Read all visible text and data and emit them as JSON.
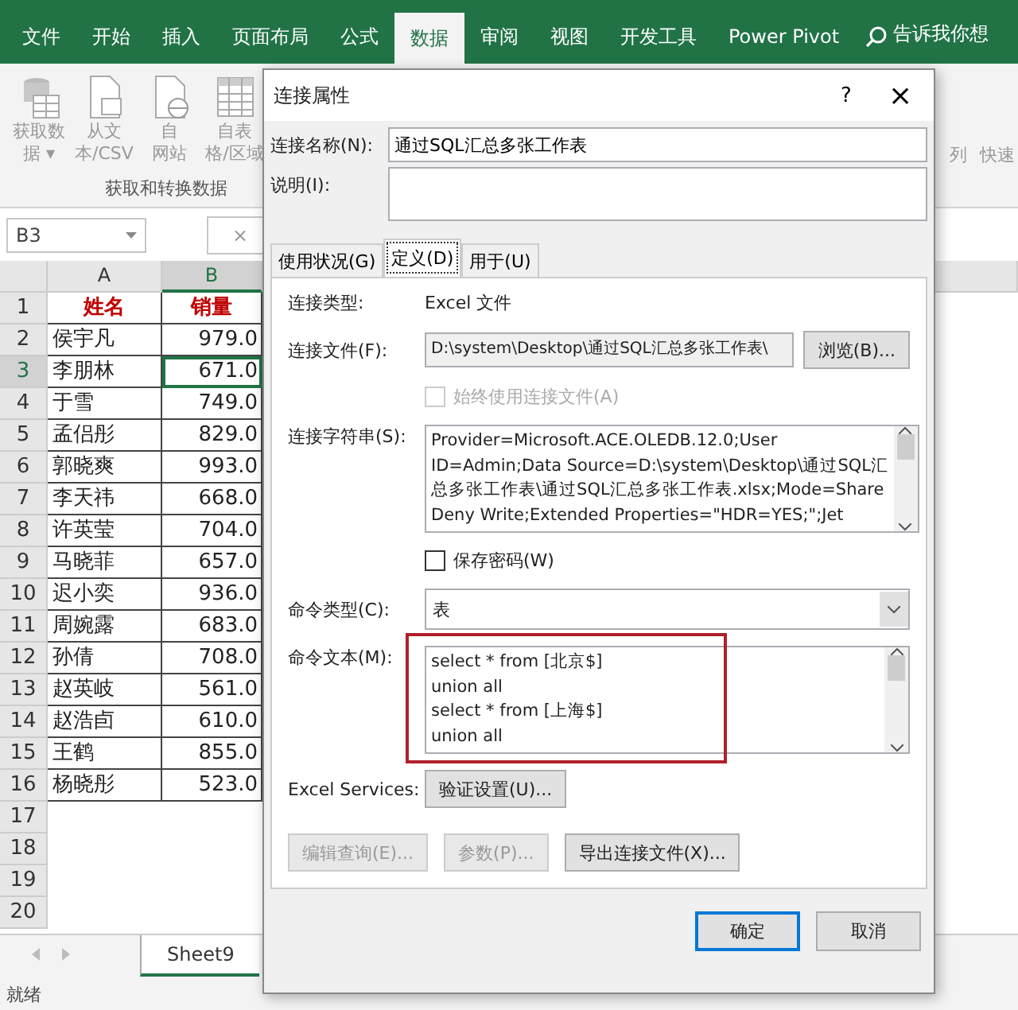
{
  "ribbon_tabs": [
    {
      "label": "文件",
      "selected": false
    },
    {
      "label": "开始",
      "selected": false
    },
    {
      "label": "插入",
      "selected": false
    },
    {
      "label": "页面布局",
      "selected": false
    },
    {
      "label": "公式",
      "selected": false
    },
    {
      "label": "数据",
      "selected": true
    },
    {
      "label": "审阅",
      "selected": false
    },
    {
      "label": "视图",
      "selected": false
    },
    {
      "label": "开发工具",
      "selected": false
    },
    {
      "label": "Power Pivot",
      "selected": false
    }
  ],
  "tell_me": "告诉我你想",
  "ribbon_buttons": [
    {
      "kind": "database",
      "lines": [
        "获取数",
        "据 ▾"
      ]
    },
    {
      "kind": "document",
      "lines": [
        "从文",
        "本/CSV"
      ]
    },
    {
      "kind": "web",
      "lines": [
        "自",
        "网站"
      ]
    },
    {
      "kind": "table",
      "lines": [
        "自表",
        "格/区域"
      ]
    }
  ],
  "ribbon_group": "获取和转换数据",
  "ribbon_right": [
    "列",
    "快速"
  ],
  "name_box": "B3",
  "formula_cancel": "×",
  "sheet": {
    "columns": [
      {
        "label": "A",
        "selected": false
      },
      {
        "label": "B",
        "selected": true
      }
    ],
    "rows": [
      {
        "num": "1",
        "selected": false,
        "cells": [
          "姓名",
          "销量"
        ],
        "kind": "header"
      },
      {
        "num": "2",
        "selected": false,
        "cells": [
          "侯宇凡",
          "979.0"
        ],
        "kind": "data"
      },
      {
        "num": "3",
        "selected": true,
        "cells": [
          "李朋林",
          "671.0"
        ],
        "kind": "data"
      },
      {
        "num": "4",
        "selected": false,
        "cells": [
          "于雪",
          "749.0"
        ],
        "kind": "data"
      },
      {
        "num": "5",
        "selected": false,
        "cells": [
          "孟侣彤",
          "829.0"
        ],
        "kind": "data"
      },
      {
        "num": "6",
        "selected": false,
        "cells": [
          "郭晓爽",
          "993.0"
        ],
        "kind": "data"
      },
      {
        "num": "7",
        "selected": false,
        "cells": [
          "李天祎",
          "668.0"
        ],
        "kind": "data"
      },
      {
        "num": "8",
        "selected": false,
        "cells": [
          "许英莹",
          "704.0"
        ],
        "kind": "data"
      },
      {
        "num": "9",
        "selected": false,
        "cells": [
          "马晓菲",
          "657.0"
        ],
        "kind": "data"
      },
      {
        "num": "10",
        "selected": false,
        "cells": [
          "迟小奕",
          "936.0"
        ],
        "kind": "data"
      },
      {
        "num": "11",
        "selected": false,
        "cells": [
          "周婉露",
          "683.0"
        ],
        "kind": "data"
      },
      {
        "num": "12",
        "selected": false,
        "cells": [
          "孙倩",
          "708.0"
        ],
        "kind": "data"
      },
      {
        "num": "13",
        "selected": false,
        "cells": [
          "赵英岐",
          "561.0"
        ],
        "kind": "data"
      },
      {
        "num": "14",
        "selected": false,
        "cells": [
          "赵浩卣",
          "610.0"
        ],
        "kind": "data"
      },
      {
        "num": "15",
        "selected": false,
        "cells": [
          "王鹤",
          "855.0"
        ],
        "kind": "data"
      },
      {
        "num": "16",
        "selected": false,
        "cells": [
          "杨晓彤",
          "523.0"
        ],
        "kind": "data"
      },
      {
        "num": "17",
        "selected": false,
        "cells": [],
        "kind": "empty"
      },
      {
        "num": "18",
        "selected": false,
        "cells": [],
        "kind": "empty"
      },
      {
        "num": "19",
        "selected": false,
        "cells": [],
        "kind": "empty"
      },
      {
        "num": "20",
        "selected": false,
        "cells": [],
        "kind": "empty"
      }
    ]
  },
  "sheet_tabs": [
    {
      "label": "Sheet9",
      "selected": true
    }
  ],
  "status_bar": "就绪",
  "dialog": {
    "title": "连接属性",
    "help": "?",
    "close": "×",
    "name_label": "连接名称(N):",
    "name_value": "通过SQL汇总多张工作表",
    "desc_label": "说明(I):",
    "tabs": [
      {
        "label": "使用状况(G)",
        "selected": false
      },
      {
        "label": "定义(D)",
        "selected": true
      },
      {
        "label": "用于(U)",
        "selected": false
      }
    ],
    "type_label": "连接类型:",
    "type_value": "Excel 文件",
    "file_label": "连接文件(F):",
    "file_value": "D:\\system\\Desktop\\通过SQL汇总多张工作表\\",
    "browse": "浏览(B)...",
    "always_use": {
      "label": "始终使用连接文件(A)",
      "checked": false,
      "disabled": true
    },
    "conn_label": "连接字符串(S):",
    "conn_lines": [
      "Provider=Microsoft.ACE.OLEDB.12.0;User",
      "ID=Admin;Data Source=D:\\system\\Desktop\\通过SQL汇",
      "总多张工作表\\通过SQL汇总多张工作表.xlsx;Mode=Share",
      "Deny Write;Extended Properties=\"HDR=YES;\";Jet"
    ],
    "save_password": {
      "label": "保存密码(W)",
      "checked": false,
      "disabled": false
    },
    "cmd_type_label": "命令类型(C):",
    "cmd_type_value": "表",
    "cmd_text_label": "命令文本(M):",
    "cmd_lines": [
      "select * from [北京$]",
      "union all",
      "select * from [上海$]",
      "union all"
    ],
    "cmd_highlighted": true,
    "services_label": "Excel Services:",
    "services_button": "验证设置(U)...",
    "actions": [
      {
        "label": "编辑查询(E)...",
        "disabled": true
      },
      {
        "label": "参数(P)...",
        "disabled": true
      },
      {
        "label": "导出连接文件(X)...",
        "disabled": false
      }
    ],
    "footer": [
      {
        "label": "确定",
        "default": true
      },
      {
        "label": "取消",
        "default": false
      }
    ]
  }
}
